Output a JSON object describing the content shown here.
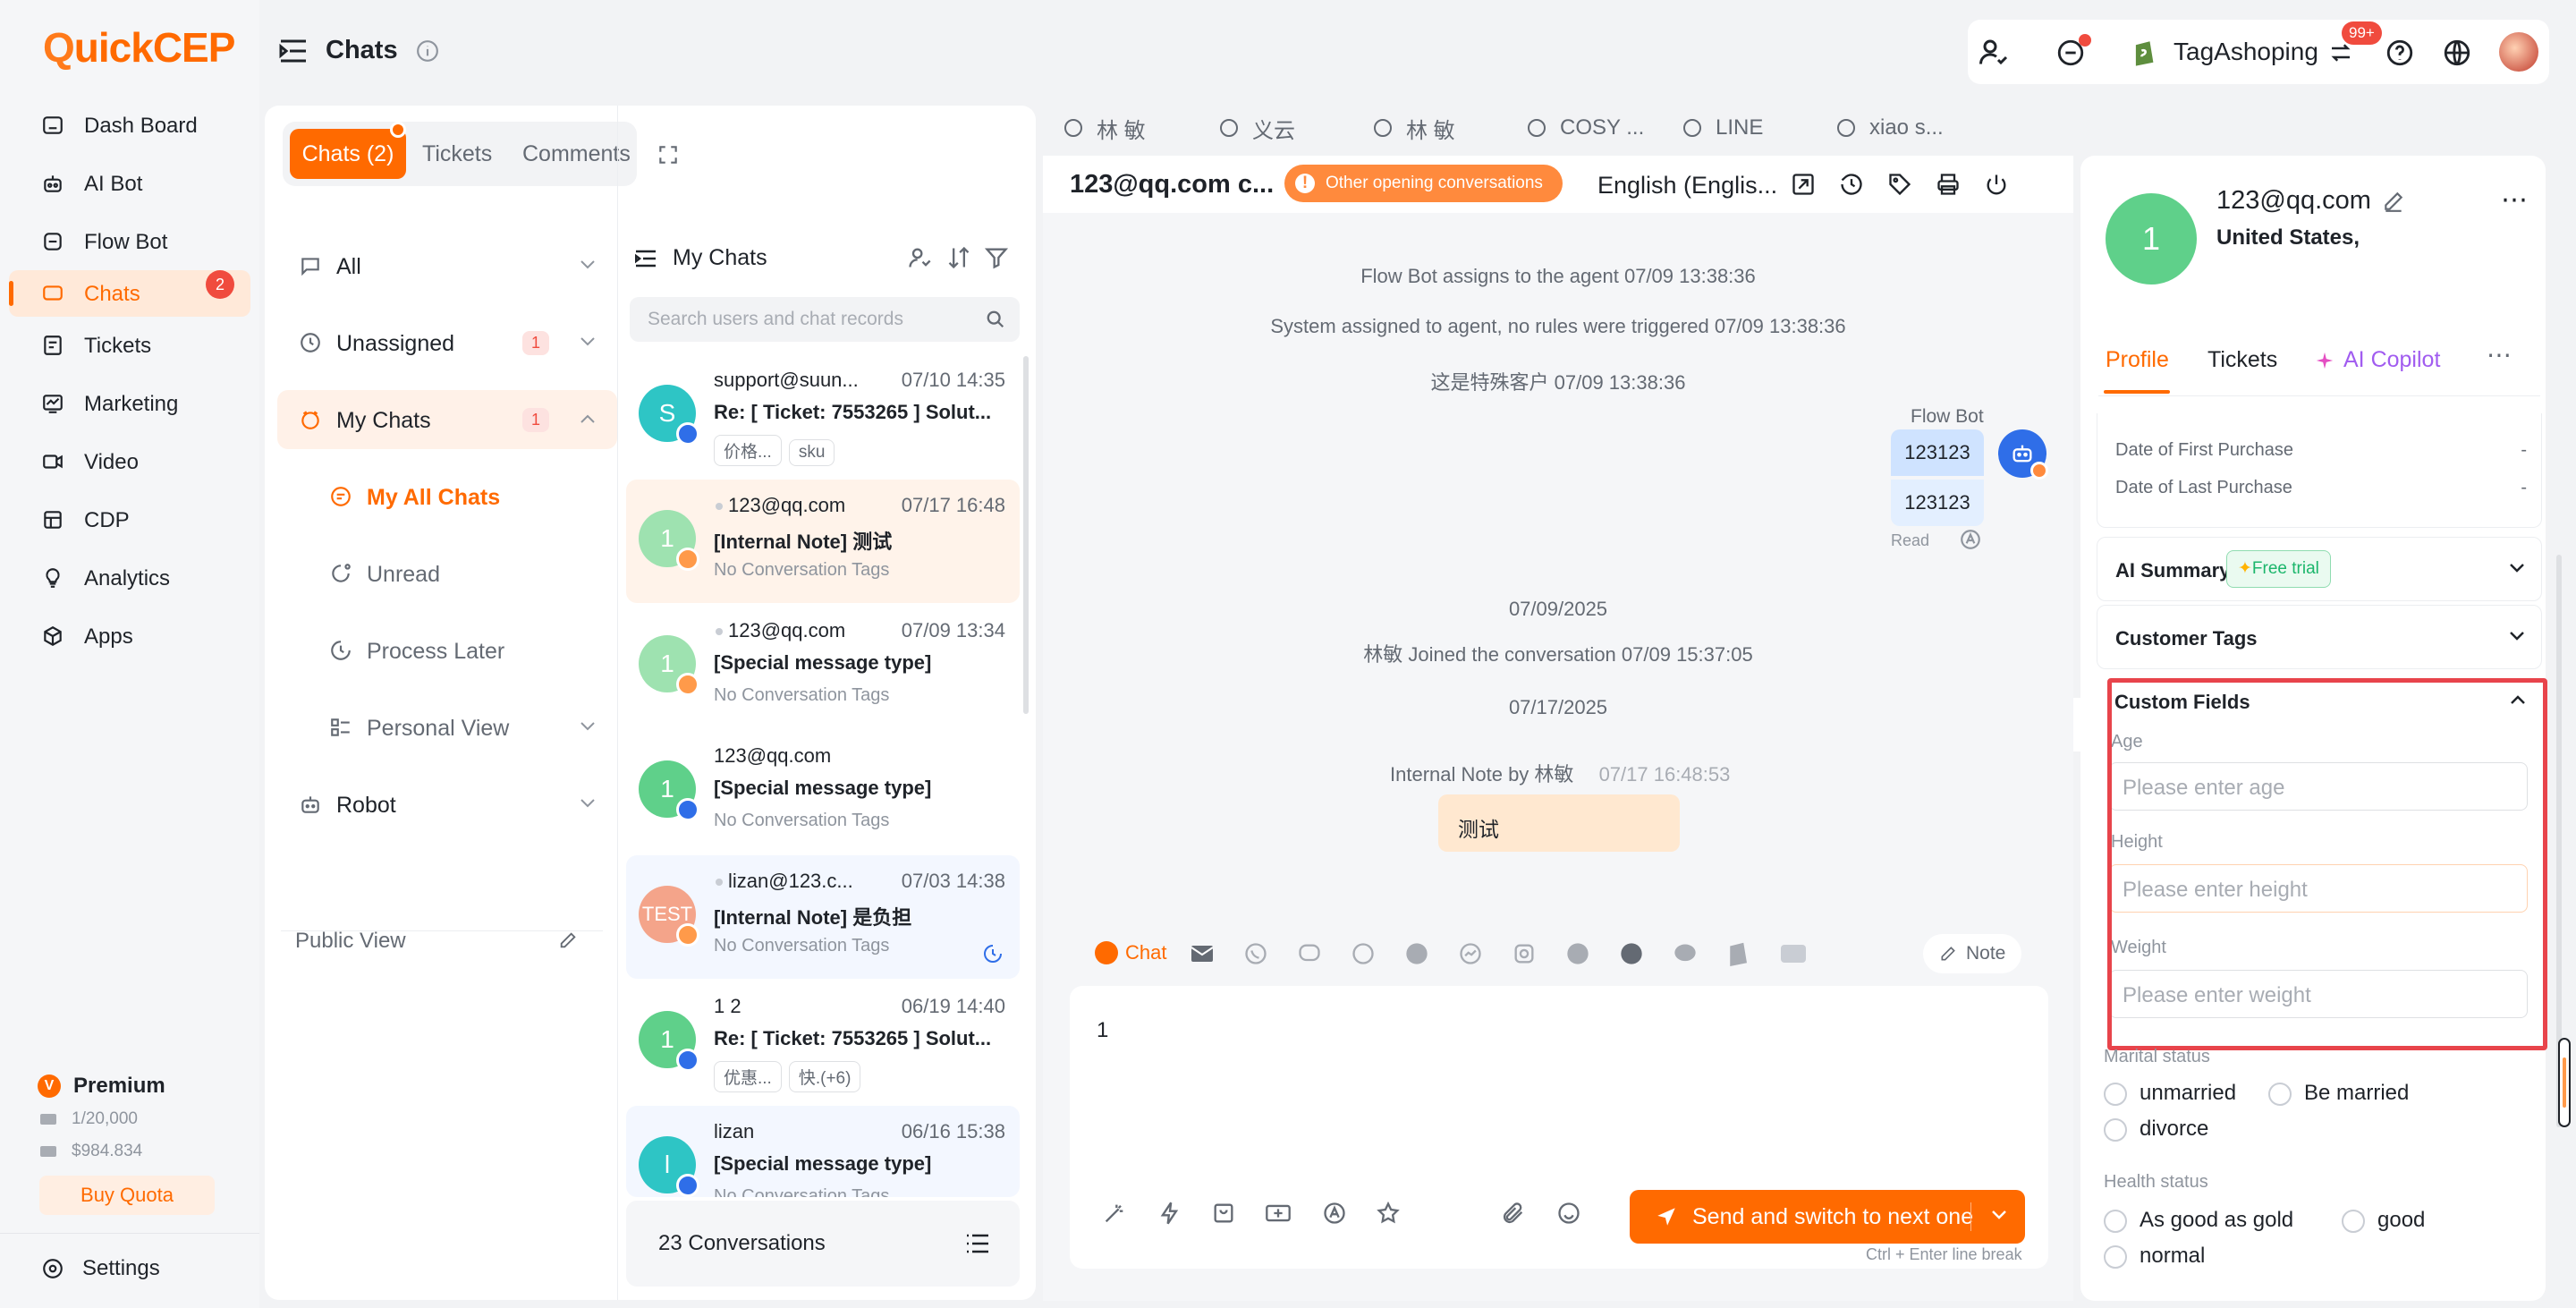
{
  "app": {
    "logo": {
      "q": "Q",
      "rest": "uickCEP"
    },
    "page_title": "Chats"
  },
  "nav": {
    "items": [
      {
        "label": "Dash Board",
        "icon": "dashboard-icon"
      },
      {
        "label": "AI Bot",
        "icon": "robot-icon"
      },
      {
        "label": "Flow Bot",
        "icon": "flowbot-icon"
      },
      {
        "label": "Chats",
        "icon": "chat-icon",
        "badge": "2"
      },
      {
        "label": "Tickets",
        "icon": "ticket-icon"
      },
      {
        "label": "Marketing",
        "icon": "marketing-icon"
      },
      {
        "label": "Video",
        "icon": "video-icon"
      },
      {
        "label": "CDP",
        "icon": "cdp-icon"
      },
      {
        "label": "Analytics",
        "icon": "bulb-icon"
      },
      {
        "label": "Apps",
        "icon": "apps-icon"
      }
    ],
    "plan": {
      "name": "Premium",
      "quota1": "1/20,000",
      "quota2": "$984.834",
      "buy": "Buy Quota"
    },
    "settings": "Settings"
  },
  "header": {
    "store": "TagAshoping",
    "notif_badge": "99+"
  },
  "chat_tabs": {
    "chats": "Chats (2)",
    "tickets": "Tickets",
    "comments": "Comments"
  },
  "filters": {
    "all": "All",
    "unassigned": "Unassigned",
    "unassigned_count": "1",
    "my_chats": "My Chats",
    "my_chats_count": "1",
    "my_all_chats": "My All Chats",
    "unread": "Unread",
    "process_later": "Process Later",
    "personal_view": "Personal View",
    "robot": "Robot",
    "public_view": "Public View"
  },
  "conv_list": {
    "title": "My Chats",
    "search_placeholder": "Search users and chat records",
    "footer": "23 Conversations",
    "items": [
      {
        "name": "support@suun...",
        "time": "07/10 14:35",
        "subject": "Re: [ Ticket: 7553265 ] Solut...",
        "tag1": "价格...",
        "tag2": "sku",
        "avatar": "S",
        "color": "#2ec5c5"
      },
      {
        "name": "123@qq.com",
        "time": "07/17 16:48",
        "subject": "[Internal Note] 测试",
        "tags": "No Conversation Tags",
        "avatar": "1",
        "color": "#9ee2b0"
      },
      {
        "name": "123@qq.com",
        "time": "07/09 13:34",
        "subject": "[Special message type]",
        "tags": "No Conversation Tags",
        "avatar": "1",
        "color": "#9ee2b0"
      },
      {
        "name": "123@qq.com",
        "time": "",
        "subject": "[Special message type]",
        "tags": "No Conversation Tags",
        "avatar": "1",
        "color": "#5fd08a"
      },
      {
        "name": "lizan@123.c...",
        "time": "07/03 14:38",
        "subject": "[Internal Note] 是负担",
        "tags": "No Conversation Tags",
        "avatar": "TEST",
        "color": "#f4a48a"
      },
      {
        "name": "1 2",
        "time": "06/19 14:40",
        "subject": "Re: [ Ticket: 7553265 ] Solut...",
        "tag1": "优惠...",
        "tag2": "快.(+6)",
        "avatar": "1",
        "color": "#5fd08a"
      },
      {
        "name": "lizan",
        "time": "06/16 15:38",
        "subject": "[Special message type]",
        "tags": "No Conversation Tags",
        "avatar": "l",
        "color": "#2ec5c5"
      }
    ]
  },
  "open_tabs": [
    "林 敏",
    "义云",
    "林 敏",
    "COSY ...",
    "LINE",
    "xiao s..."
  ],
  "chat_header": {
    "contact": "123@qq.com c...",
    "other_opening": "Other opening conversations",
    "language": "English (Englis..."
  },
  "messages": {
    "m1": "Flow Bot assigns to the agent  07/09 13:38:36",
    "m2": "System assigned to agent, no rules were triggered  07/09 13:38:36",
    "m3": "这是特殊客户  07/09 13:38:36",
    "bot_name": "Flow Bot",
    "bot_msg1": "123123",
    "bot_msg2": "123123",
    "read": "Read",
    "date1": "07/09/2025",
    "joined": "林敏 Joined the conversation  07/09 15:37:05",
    "date2": "07/17/2025",
    "note_by": "Internal Note by 林敏",
    "note_time": "07/17 16:48:53",
    "note_text": "测试"
  },
  "composer": {
    "chat": "Chat",
    "note": "Note",
    "text": "1",
    "send": "Send and switch to next one",
    "hint": "Ctrl + Enter line break"
  },
  "profile": {
    "avatar": "1",
    "email": "123@qq.com",
    "location": "United States,",
    "tabs": {
      "profile": "Profile",
      "tickets": "Tickets",
      "ai": "AI Copilot"
    },
    "first_purchase_label": "Date of First Purchase",
    "first_purchase_value": "-",
    "last_purchase_label": "Date of Last Purchase",
    "last_purchase_value": "-",
    "ai_summary": "AI Summary",
    "free_trial": "Free trial",
    "customer_tags": "Customer Tags",
    "custom_fields": "Custom Fields",
    "age_label": "Age",
    "age_placeholder": "Please enter age",
    "height_label": "Height",
    "height_placeholder": "Please enter height",
    "weight_label": "Weight",
    "weight_placeholder": "Please enter weight",
    "marital_label": "Marital status",
    "marital": [
      "unmarried",
      "Be married",
      "divorce"
    ],
    "health_label": "Health status",
    "health": [
      "As good as gold",
      "good",
      "normal"
    ]
  },
  "colors": {
    "accent": "#ff6a00",
    "highlight": "#e8444b"
  }
}
